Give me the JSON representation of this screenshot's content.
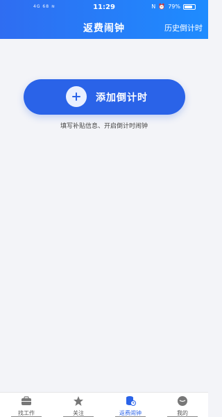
{
  "status_bar": {
    "left_text": "4G 68 ≋",
    "time": "11:29",
    "battery_percent_text": "79%",
    "battery_level": 0.79
  },
  "header": {
    "title": "返费闹钟",
    "history_link": "历史倒计时"
  },
  "main": {
    "add_button_label": "添加倒计时",
    "hint": "填写补贴信息、开启倒计时闹钟"
  },
  "tabbar": {
    "items": [
      {
        "label": "找工作",
        "icon": "briefcase-icon",
        "active": false
      },
      {
        "label": "关注",
        "icon": "star-icon",
        "active": false
      },
      {
        "label": "返费闹钟",
        "icon": "coins-clock-icon",
        "active": true
      },
      {
        "label": "我的",
        "icon": "profile-icon",
        "active": false
      }
    ]
  },
  "colors": {
    "header_start": "#2f6df1",
    "header_end": "#1e8cff",
    "accent": "#2a63e8",
    "background": "#f3f4f8"
  }
}
